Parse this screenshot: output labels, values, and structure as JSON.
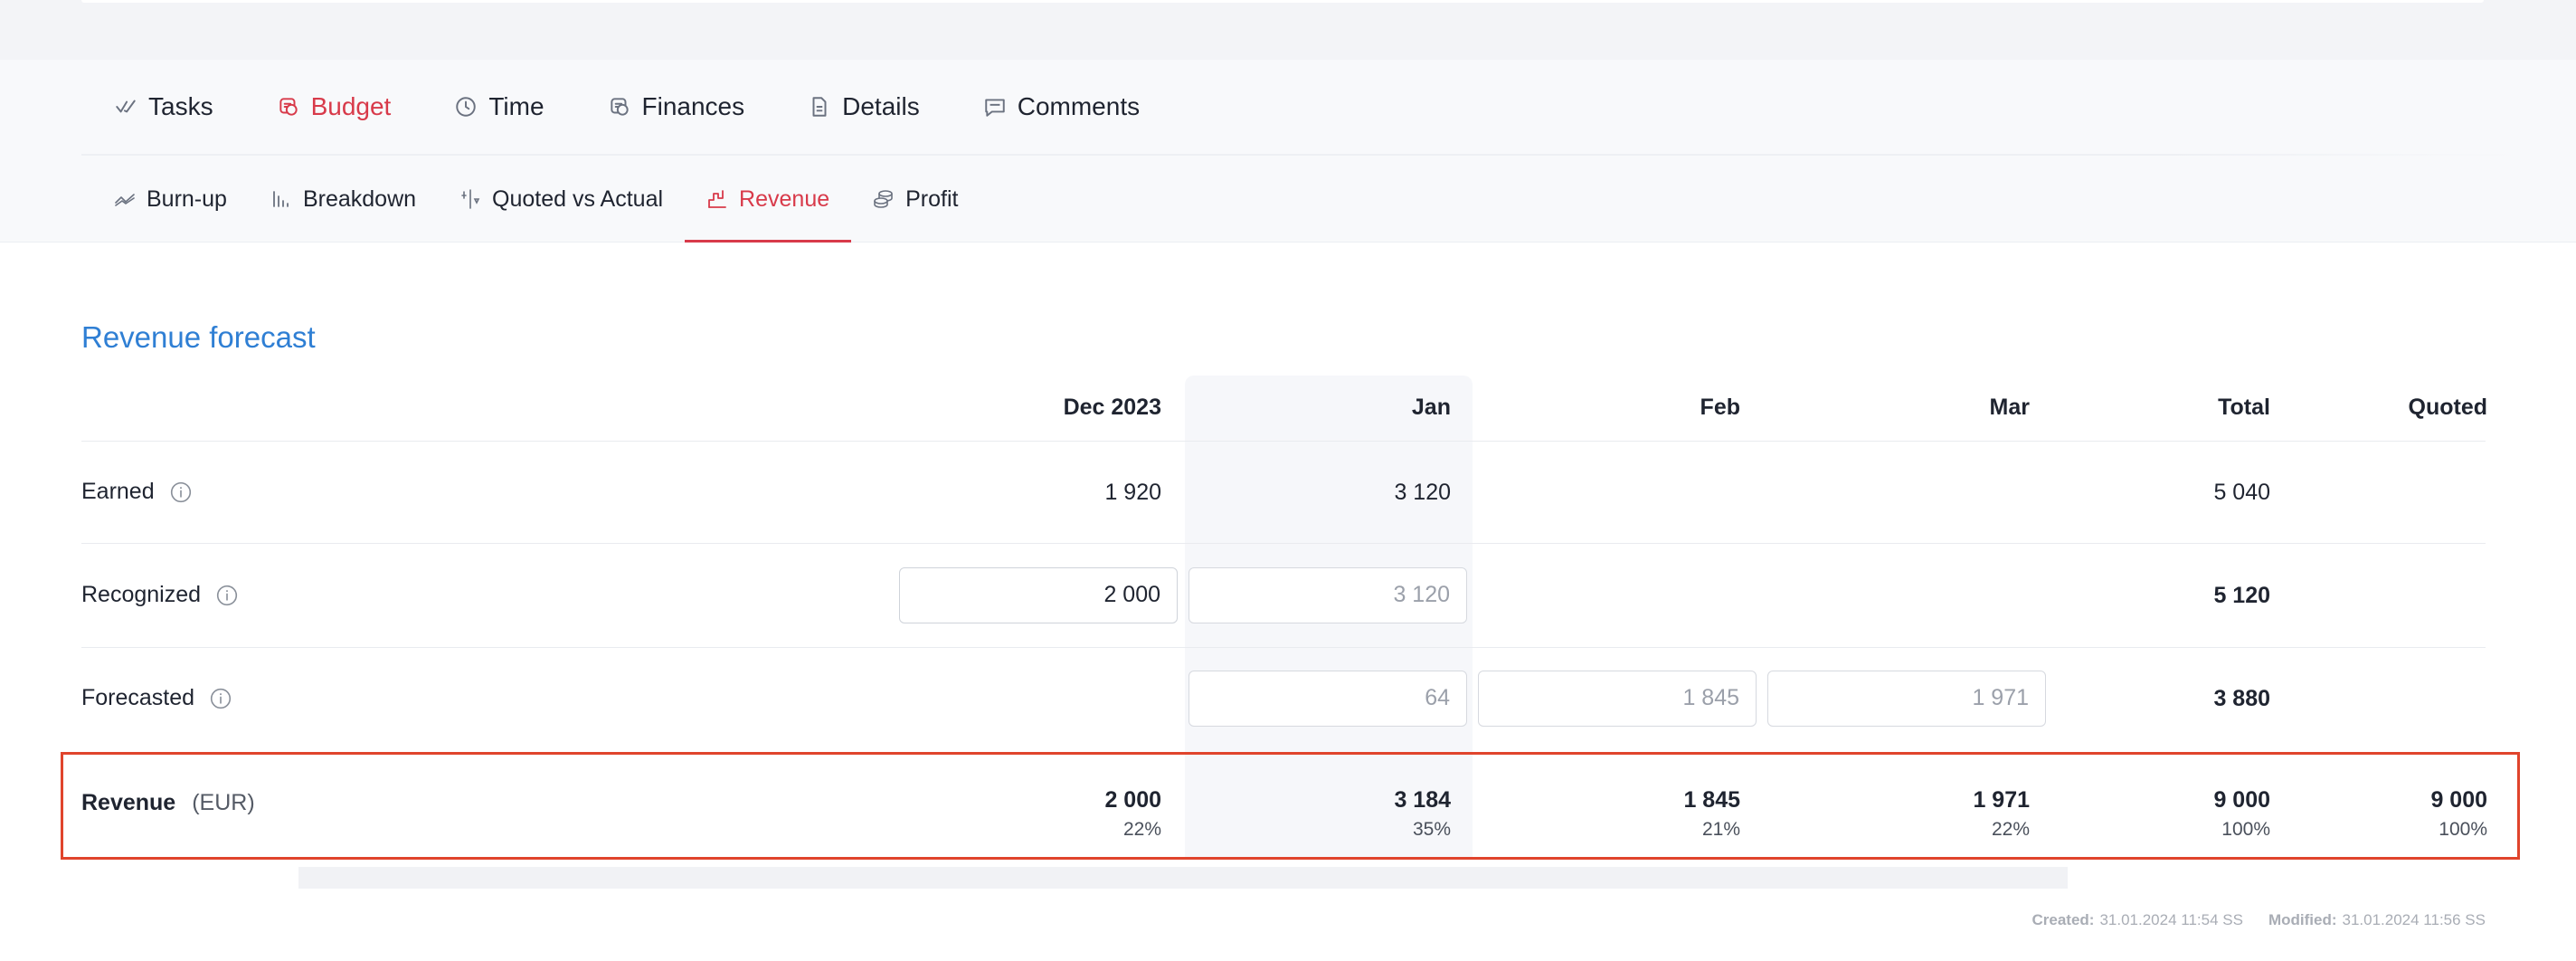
{
  "main_tabs": [
    {
      "label": "Tasks",
      "icon": "checkmarks-icon",
      "active": false
    },
    {
      "label": "Budget",
      "icon": "coins-icon",
      "active": true
    },
    {
      "label": "Time",
      "icon": "clock-icon",
      "active": false
    },
    {
      "label": "Finances",
      "icon": "coins-icon",
      "active": false
    },
    {
      "label": "Details",
      "icon": "document-icon",
      "active": false
    },
    {
      "label": "Comments",
      "icon": "speech-bubble-icon",
      "active": false
    }
  ],
  "sub_tabs": [
    {
      "label": "Burn-up",
      "icon": "burnup-chart-icon",
      "active": false
    },
    {
      "label": "Breakdown",
      "icon": "bar-chart-icon",
      "active": false
    },
    {
      "label": "Quoted vs Actual",
      "icon": "compare-icon",
      "active": false
    },
    {
      "label": "Revenue",
      "icon": "step-chart-icon",
      "active": true
    },
    {
      "label": "Profit",
      "icon": "coin-stack-icon",
      "active": false
    }
  ],
  "section": {
    "title": "Revenue forecast"
  },
  "columns": [
    "Dec 2023",
    "Jan",
    "Feb",
    "Mar",
    "Total",
    "Quoted"
  ],
  "rows": {
    "earned": {
      "label": "Earned",
      "dec": "1 920",
      "jan": "3 120",
      "total": "5 040"
    },
    "recognized": {
      "label": "Recognized",
      "dec_value": "2 000",
      "jan_placeholder": "3 120",
      "total": "5 120"
    },
    "forecasted": {
      "label": "Forecasted",
      "jan_placeholder": "64",
      "feb_placeholder": "1 845",
      "mar_placeholder": "1 971",
      "total": "3 880"
    },
    "revenue": {
      "label": "Revenue",
      "unit": "(EUR)",
      "values": [
        "2 000",
        "3 184",
        "1 845",
        "1 971",
        "9 000",
        "9 000"
      ],
      "percents": [
        "22%",
        "35%",
        "21%",
        "22%",
        "100%",
        "100%"
      ]
    }
  },
  "footer": {
    "created_label": "Created:",
    "created_value": "31.01.2024 11:54 SS",
    "modified_label": "Modified:",
    "modified_value": "31.01.2024 11:56 SS"
  },
  "colors": {
    "accent": "#d83a4a",
    "title": "#2f7fd4",
    "highlight": "#e0442c"
  }
}
